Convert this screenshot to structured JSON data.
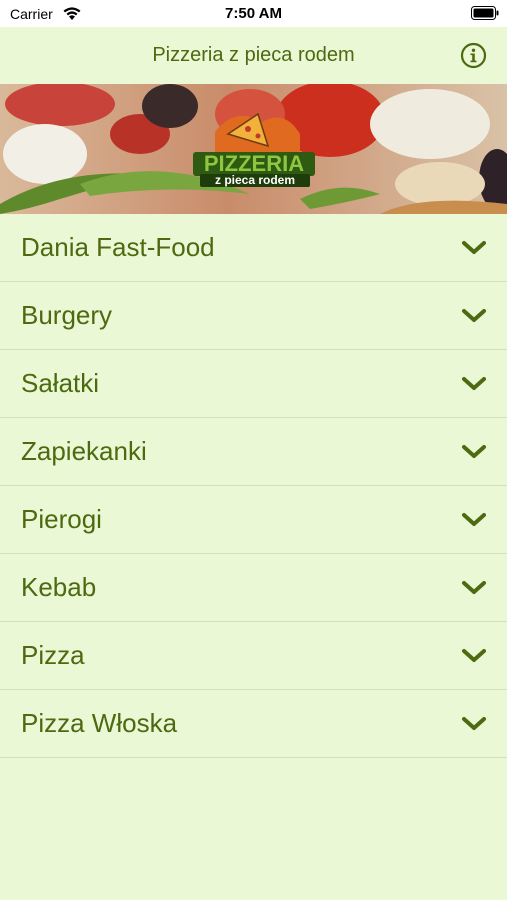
{
  "status_bar": {
    "carrier": "Carrier",
    "time": "7:50 AM"
  },
  "nav": {
    "title": "Pizzeria z pieca rodem",
    "info_icon": "info-icon"
  },
  "banner": {
    "logo_line1": "PIZZERIA",
    "logo_line2": "z pieca rodem"
  },
  "menu": {
    "items": [
      {
        "label": "Dania Fast-Food"
      },
      {
        "label": "Burgery"
      },
      {
        "label": "Sałatki"
      },
      {
        "label": "Zapiekanki"
      },
      {
        "label": "Pierogi"
      },
      {
        "label": "Kebab"
      },
      {
        "label": "Pizza"
      },
      {
        "label": "Pizza Włoska"
      }
    ]
  },
  "colors": {
    "accent": "#4d6a10",
    "background": "#eaf8d6",
    "divider": "#d3dfc3"
  }
}
